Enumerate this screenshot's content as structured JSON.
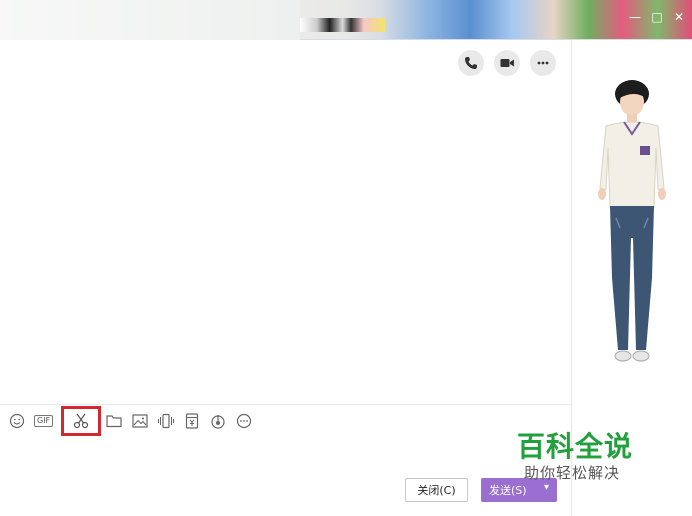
{
  "window": {
    "min_symbol": "—",
    "max_symbol": "□",
    "close_symbol": "✕"
  },
  "call_bar": {
    "icons": [
      "phone-icon",
      "video-icon",
      "more-icon"
    ]
  },
  "toolbar": {
    "gif_label": "GIF",
    "icons": [
      "emoji-icon",
      "gif-icon",
      "scissors-icon",
      "folder-icon",
      "image-icon",
      "shake-icon",
      "red-packet-icon",
      "music-icon",
      "more-options-icon"
    ]
  },
  "buttons": {
    "close_label": "关闭(C)",
    "send_label": "发送(S)",
    "send_arrow": "▾"
  },
  "watermark": {
    "title": "百科全说",
    "subtitle": "助你轻松解决"
  },
  "colors": {
    "highlight": "#d3272e",
    "send_button": "#9b6fd1",
    "watermark_green": "#22a03c"
  }
}
